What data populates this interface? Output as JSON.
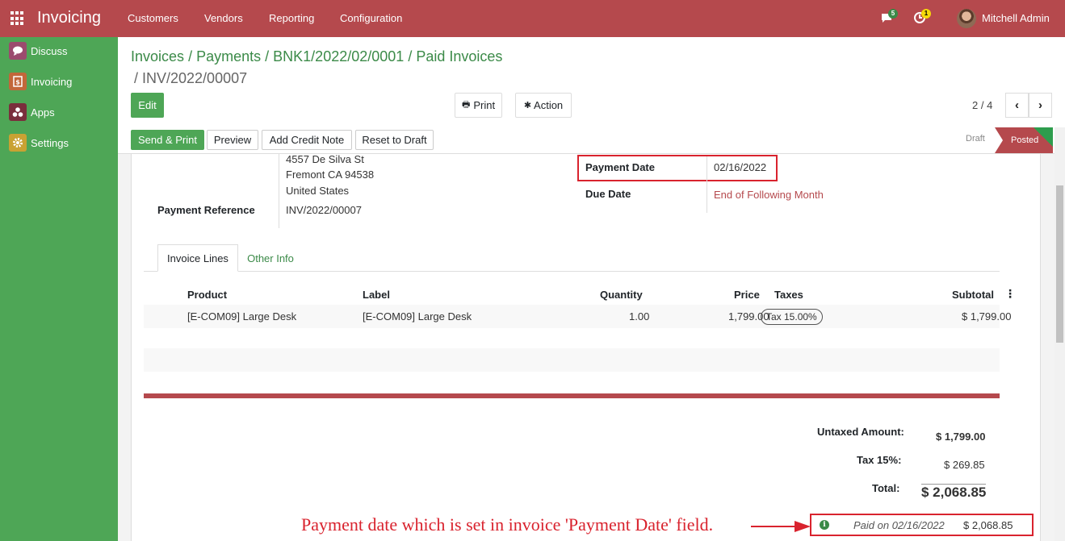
{
  "topbar": {
    "app_title": "Invoicing",
    "menu": [
      "Customers",
      "Vendors",
      "Reporting",
      "Configuration"
    ],
    "messages_badge": "5",
    "activities_badge": "1",
    "user_name": "Mitchell Admin"
  },
  "sidebar": {
    "items": [
      {
        "label": "Discuss",
        "icon": "chat-icon",
        "color": "#9b4b6e"
      },
      {
        "label": "Invoicing",
        "icon": "invoice-icon",
        "color": "#c2673a"
      },
      {
        "label": "Apps",
        "icon": "apps-icon",
        "color": "#7a2e3c"
      },
      {
        "label": "Settings",
        "icon": "gear-icon",
        "color": "#c9a233"
      }
    ]
  },
  "breadcrumb": {
    "items": [
      "Invoices",
      "Payments",
      "BNK1/2022/02/0001",
      "Paid Invoices"
    ],
    "current": "/ INV/2022/00007"
  },
  "controls": {
    "edit": "Edit",
    "print": "Print",
    "action": "Action",
    "pager": "2 / 4"
  },
  "statusbar": {
    "buttons": [
      "Send & Print",
      "Preview",
      "Add Credit Note",
      "Reset to Draft"
    ],
    "stage_draft": "Draft",
    "stage_posted": "Posted"
  },
  "form": {
    "address_lines": [
      "4557 De Silva St",
      "Fremont CA 94538",
      "United States"
    ],
    "payment_reference_label": "Payment Reference",
    "payment_reference": "INV/2022/00007",
    "payment_date_label": "Payment Date",
    "payment_date": "02/16/2022",
    "due_date_label": "Due Date",
    "due_date": "End of Following Month"
  },
  "tabs": [
    "Invoice Lines",
    "Other Info"
  ],
  "lines": {
    "headers": [
      "Product",
      "Label",
      "Quantity",
      "Price",
      "Taxes",
      "Subtotal"
    ],
    "rows": [
      {
        "product": "[E-COM09] Large Desk",
        "label": "[E-COM09] Large Desk",
        "quantity": "1.00",
        "price": "1,799.00",
        "taxes": "Tax 15.00%",
        "subtotal": "$ 1,799.00"
      }
    ]
  },
  "totals": {
    "untaxed_label": "Untaxed Amount:",
    "untaxed": "$ 1,799.00",
    "tax_label": "Tax 15%:",
    "tax": "$ 269.85",
    "total_label": "Total:",
    "total": "$ 2,068.85",
    "paid_on": "Paid on 02/16/2022",
    "paid_amount": "$ 2,068.85"
  },
  "annotation": "Payment date which is set in invoice 'Payment Date' field.",
  "colors": {
    "topbar": "#b5494d",
    "sidebar": "#4ea656",
    "link_green": "#3b8a48",
    "highlight_red": "#d9232e"
  }
}
